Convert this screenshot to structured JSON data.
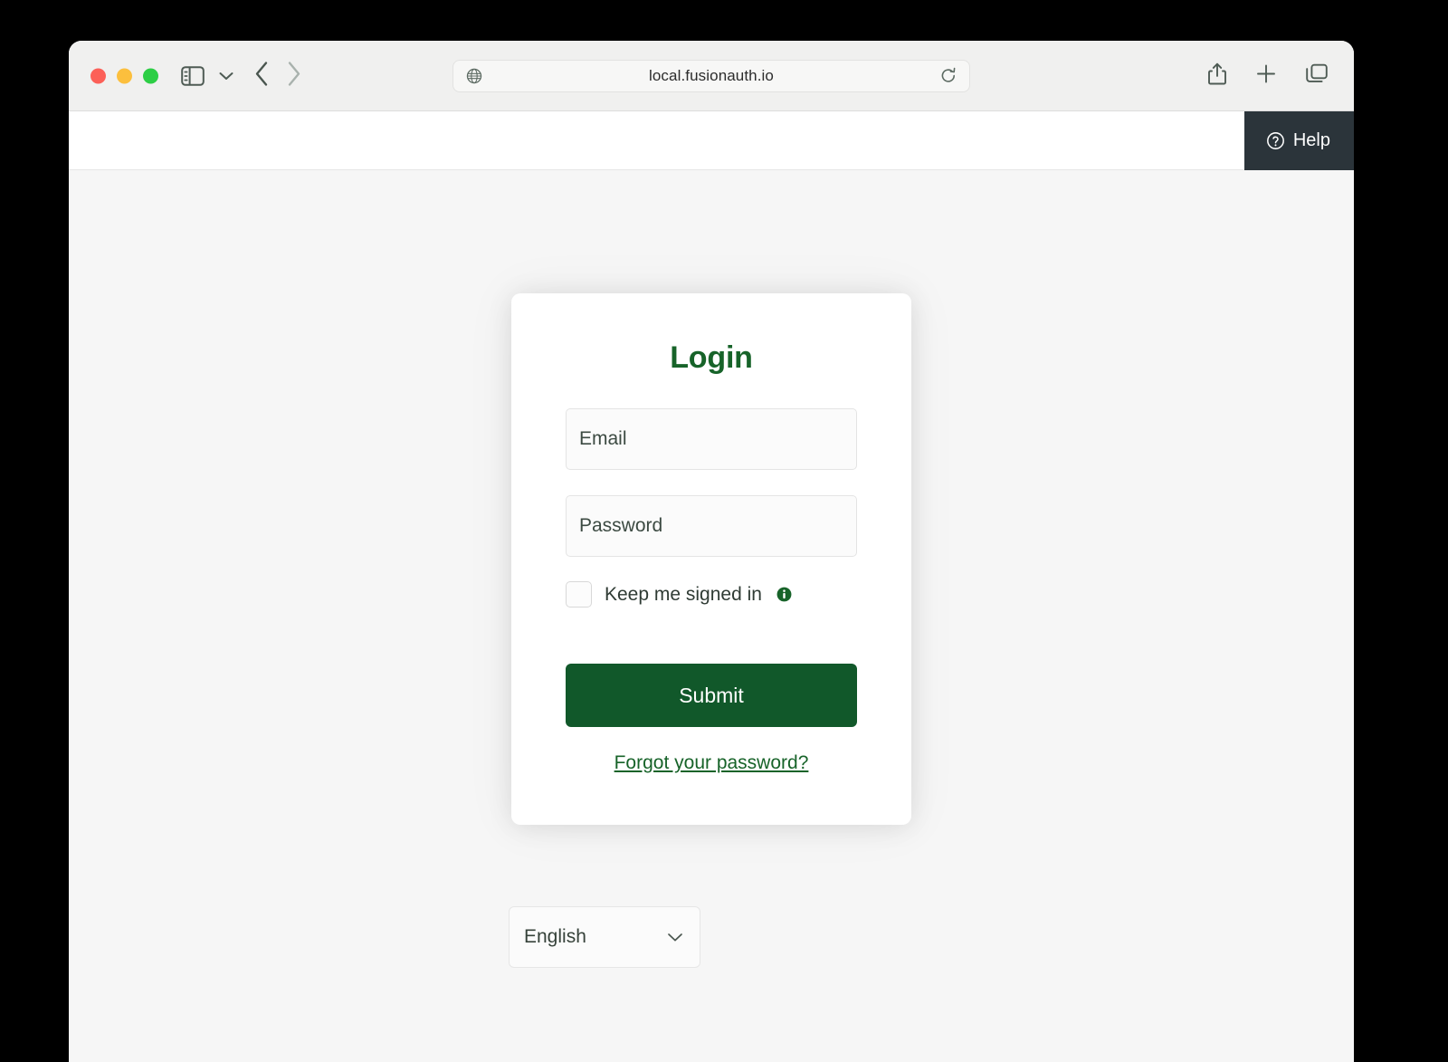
{
  "browser": {
    "url": "local.fusionauth.io",
    "traffic_lights": [
      "close-red",
      "minimize-yellow",
      "maximize-green"
    ],
    "icons": {
      "sidebar": "sidebar-toggle-icon",
      "sidebar_chevron": "chevron-down-icon",
      "back": "back-arrow-icon",
      "forward": "forward-arrow-icon",
      "globe": "globe-icon",
      "reload": "reload-icon",
      "share": "share-icon",
      "new_tab": "plus-icon",
      "tab_overview": "tab-overview-icon"
    }
  },
  "app_header": {
    "help_label": "Help",
    "help_icon": "question-circle-icon",
    "help_background": "#2b343a"
  },
  "login": {
    "title": "Login",
    "title_color": "#176329",
    "email_placeholder": "Email",
    "password_placeholder": "Password",
    "email_value": "",
    "password_value": "",
    "keep_signed_in_label": "Keep me signed in",
    "keep_signed_in_checked": false,
    "info_icon": "info-circle-icon",
    "submit_label": "Submit",
    "submit_color": "#11582a",
    "forgot_password_label": "Forgot your password?"
  },
  "language": {
    "selected": "English",
    "chevron_icon": "chevron-down-icon"
  }
}
